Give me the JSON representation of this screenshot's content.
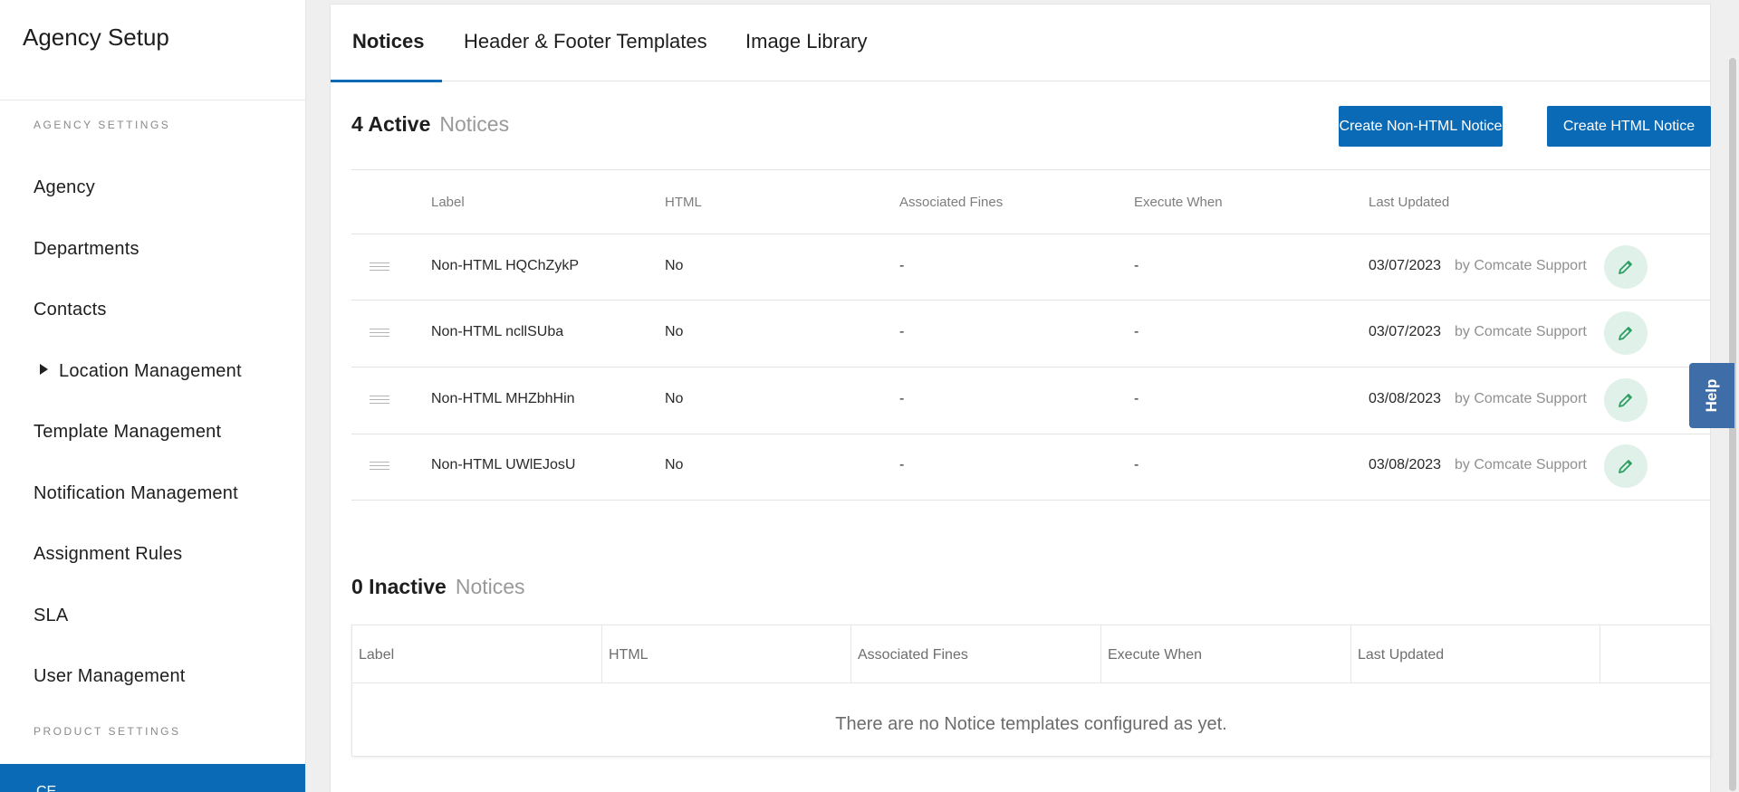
{
  "sidebar": {
    "title": "Agency Setup",
    "section_agency": "AGENCY SETTINGS",
    "items": [
      {
        "label": "Agency"
      },
      {
        "label": "Departments"
      },
      {
        "label": "Contacts"
      },
      {
        "label": "Location Management"
      },
      {
        "label": "Template Management"
      },
      {
        "label": "Notification Management"
      },
      {
        "label": "Assignment Rules"
      },
      {
        "label": "SLA"
      },
      {
        "label": "User Management"
      }
    ],
    "section_product": "PRODUCT SETTINGS",
    "active_item": "CE"
  },
  "tabs": [
    {
      "label": "Notices"
    },
    {
      "label": "Header & Footer Templates"
    },
    {
      "label": "Image Library"
    }
  ],
  "active": {
    "count": "4 Active",
    "suffix": "Notices",
    "create_non_html_label": "Create Non-HTML Notice",
    "create_html_label": "Create HTML Notice",
    "columns": [
      "Label",
      "HTML",
      "Associated Fines",
      "Execute When",
      "Last Updated"
    ],
    "rows": [
      {
        "label": "Non-HTML HQChZykP",
        "html": "No",
        "fines": "-",
        "execute": "-",
        "date": "03/07/2023",
        "by": "by Comcate Support"
      },
      {
        "label": "Non-HTML ncllSUba",
        "html": "No",
        "fines": "-",
        "execute": "-",
        "date": "03/07/2023",
        "by": "by Comcate Support"
      },
      {
        "label": "Non-HTML MHZbhHin",
        "html": "No",
        "fines": "-",
        "execute": "-",
        "date": "03/08/2023",
        "by": "by Comcate Support"
      },
      {
        "label": "Non-HTML UWlEJosU",
        "html": "No",
        "fines": "-",
        "execute": "-",
        "date": "03/08/2023",
        "by": "by Comcate Support"
      }
    ]
  },
  "inactive": {
    "count": "0 Inactive",
    "suffix": "Notices",
    "columns": [
      "Label",
      "HTML",
      "Associated Fines",
      "Execute When",
      "Last Updated"
    ],
    "empty_message": "There are no Notice templates configured as yet."
  },
  "help_label": "Help",
  "colors": {
    "primary": "#0a6ab5",
    "edit_bg": "#dff1e8",
    "edit_icon": "#2e9e63",
    "help_bg": "#3e6da8"
  }
}
